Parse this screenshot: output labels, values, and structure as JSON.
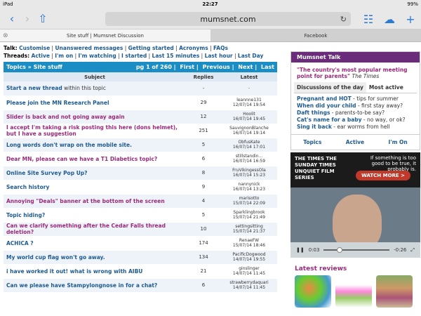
{
  "statusbar": {
    "carrier": "iPad",
    "time": "22:27",
    "battery": "99%"
  },
  "browser": {
    "url": "mumsnet.com",
    "tabs": [
      {
        "label": "Site stuff | Mumsnet Discussion"
      },
      {
        "label": "Facebook"
      }
    ]
  },
  "faint_header": "Mumsnet Talk",
  "talk_links": {
    "label": "Talk:",
    "items": [
      "Customise",
      "Unanswered messages",
      "Getting started",
      "Acronyms",
      "FAQs"
    ]
  },
  "thread_links": {
    "label": "Threads:",
    "items": [
      "Active",
      "I'm on",
      "I'm watching",
      "I started",
      "Last 15 minutes",
      "Last hour",
      "Last Day"
    ]
  },
  "topic_bar": {
    "breadcrumb": "Topics » Site stuff",
    "page": "pg 1 of 260",
    "nav": [
      "First",
      "Previous",
      "Next",
      "Last"
    ]
  },
  "columns": [
    "Subject",
    "Replies",
    "Latest"
  ],
  "rows": [
    {
      "subject": "Start a new thread",
      "suffix": " within this topic",
      "replies": "-",
      "latest": "-"
    },
    {
      "subject": "Please join the MN Research Panel",
      "replies": "29",
      "latest": "leannne131\n12/07/14 19:54"
    },
    {
      "subject": "Slider is back and not going away again",
      "replies": "12",
      "latest": "Hoolit\n16/07/14 19:45"
    },
    {
      "subject": "I accept I'm taking a risk posting this here (dons helmet), but I have a suggestion",
      "replies": "251",
      "latest": "SauvignonBlanche\n16/07/14 19:14"
    },
    {
      "subject": "Long words don't wrap on the mobile site.",
      "replies": "5",
      "latest": "ObfusKate\n16/07/14 17:01"
    },
    {
      "subject": "Dear MN, please can we have a T1 Diabetics topic?",
      "replies": "6",
      "latest": "stillstandin...\n16/07/14 16:59"
    },
    {
      "subject": "Online Site Survey Pop Up?",
      "replies": "8",
      "latest": "FruVikingessOla\n16/07/14 15:23"
    },
    {
      "subject": "Search history",
      "replies": "9",
      "latest": "nannynick\n16/07/14 13:23"
    },
    {
      "subject": "Annoying \"Deals\" banner at the bottom of the screen",
      "replies": "4",
      "latest": "marisotto\n15/07/14 22:09"
    },
    {
      "subject": "Topic hiding?",
      "replies": "5",
      "latest": "Sparklingbrook\n15/07/14 21:49"
    },
    {
      "subject": "Can we clarify something after the Cedar Falls thread deletion?",
      "replies": "10",
      "latest": "settingsitting\n15/07/14 21:37"
    },
    {
      "subject": "ACHICA ?",
      "replies": "174",
      "latest": "RenaeFW\n15/07/14 18:46"
    },
    {
      "subject": "My world cup flag won't go away.",
      "replies": "134",
      "latest": "PacificDogwood\n14/07/14 19:55"
    },
    {
      "subject": "i have worked it out! what is wrong with AIBU",
      "replies": "21",
      "latest": "ginslinger\n14/07/14 11:45"
    },
    {
      "subject": "Can we please have Stampylongnose in for a chat?",
      "replies": "6",
      "latest": "strawberrydaquari\n14/07/14 11:45"
    }
  ],
  "talk_panel": {
    "title": "Mumsnet Talk",
    "quote": "\"The country's most popular meeting point for parents\"",
    "source": "The Times",
    "tabs": [
      "Discussions of the day",
      "Most active"
    ],
    "items": [
      {
        "title": "Pregnant and HOT",
        "desc": " - tips for summer"
      },
      {
        "title": "When did your child",
        "desc": " - first stay away?"
      },
      {
        "title": "Daft things",
        "desc": " - parents-to-be say?"
      },
      {
        "title": "Cat's name for a baby",
        "desc": " - no way, or ok?"
      },
      {
        "title": "Sing it back",
        "desc": " - ear worms from hell"
      }
    ],
    "links": [
      "Topics",
      "Active",
      "I'm On"
    ]
  },
  "video_ad": {
    "brand": "THE TIMES THE SUNDAY TIMES UNQUIET FILM SERIES",
    "message": "If something is too good to be true, it probably is.",
    "cta": "WATCH MORE >",
    "time_elapsed": "0:03",
    "time_left": "-0:26"
  },
  "reviews": {
    "title": "Latest reviews"
  },
  "colors": {
    "accent_blue": "#1a8ec4",
    "talk_purple": "#6a2b7a",
    "link": "#1c5a92"
  }
}
